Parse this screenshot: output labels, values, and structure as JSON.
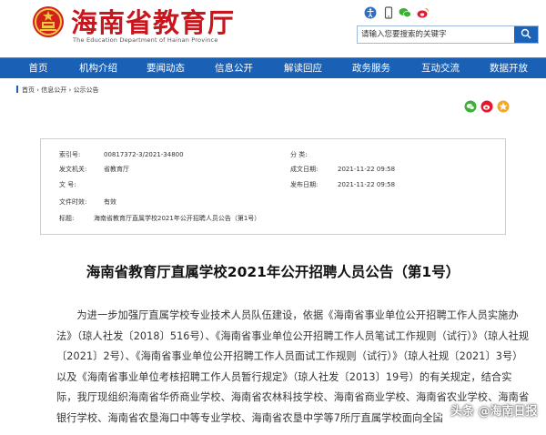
{
  "header": {
    "site_title": "海南省教育厅",
    "site_en": "The Education Department of Hainan Province",
    "search_placeholder": "请输入您要搜索的关键字"
  },
  "tool_icons": [
    "accessibility-icon",
    "mobile-icon",
    "wechat-icon",
    "weibo-icon"
  ],
  "nav": [
    "首页",
    "机构介绍",
    "要闻动态",
    "信息公开",
    "解读回应",
    "政务服务",
    "互动交流",
    "数据开放"
  ],
  "breadcrumb": {
    "home": "首页",
    "sep1": "›",
    "level1": "信息公开",
    "sep2": "›",
    "level2": "公示公告"
  },
  "meta": {
    "index_label": "索引号:",
    "index_value": "00817372-3/2021-34800",
    "category_label": "分    类:",
    "category_value": "",
    "issuer_label": "发文机关:",
    "issuer_value": "省教育厅",
    "created_label": "成文日期:",
    "created_value": "2021-11-22 09:58",
    "docno_label": "文    号:",
    "docno_value": "",
    "published_label": "发布日期:",
    "published_value": "2021-11-22 09:58",
    "validity_label": "文件时效:",
    "validity_value": "有效",
    "subject_label": "标题:",
    "subject_value": "海南省教育厅直属学校2021年公开招聘人员公告（第1号）"
  },
  "article": {
    "title": "海南省教育厅直属学校2021年公开招聘人员公告（第1号）",
    "body": "为进一步加强厅直属学校专业技术人员队伍建设，依据《海南省事业单位公开招聘工作人员实施办法》（琼人社发〔2018〕516号）、《海南省事业单位公开招聘工作人员笔试工作规则（试行）》（琼人社规〔2021〕2号）、《海南省事业单位公开招聘工作人员面试工作规则（试行）》（琼人社规〔2021〕3号）以及《海南省事业单位考核招聘工作人员暂行规定》（琼人社发〔2013〕19号）的有关规定，结合实际，我厅现组织海南省华侨商业学校、海南省农林科技学校、海南省商业学校、海南省农业学校、海南省银行学校、海南省农垦海口中等专业学校、海南省农垦中学等7所厅直属学校面向全国"
  },
  "watermark": "头条 @海南日报",
  "colors": {
    "brand_red": "#c8161d",
    "nav_blue": "#1a61b5"
  }
}
